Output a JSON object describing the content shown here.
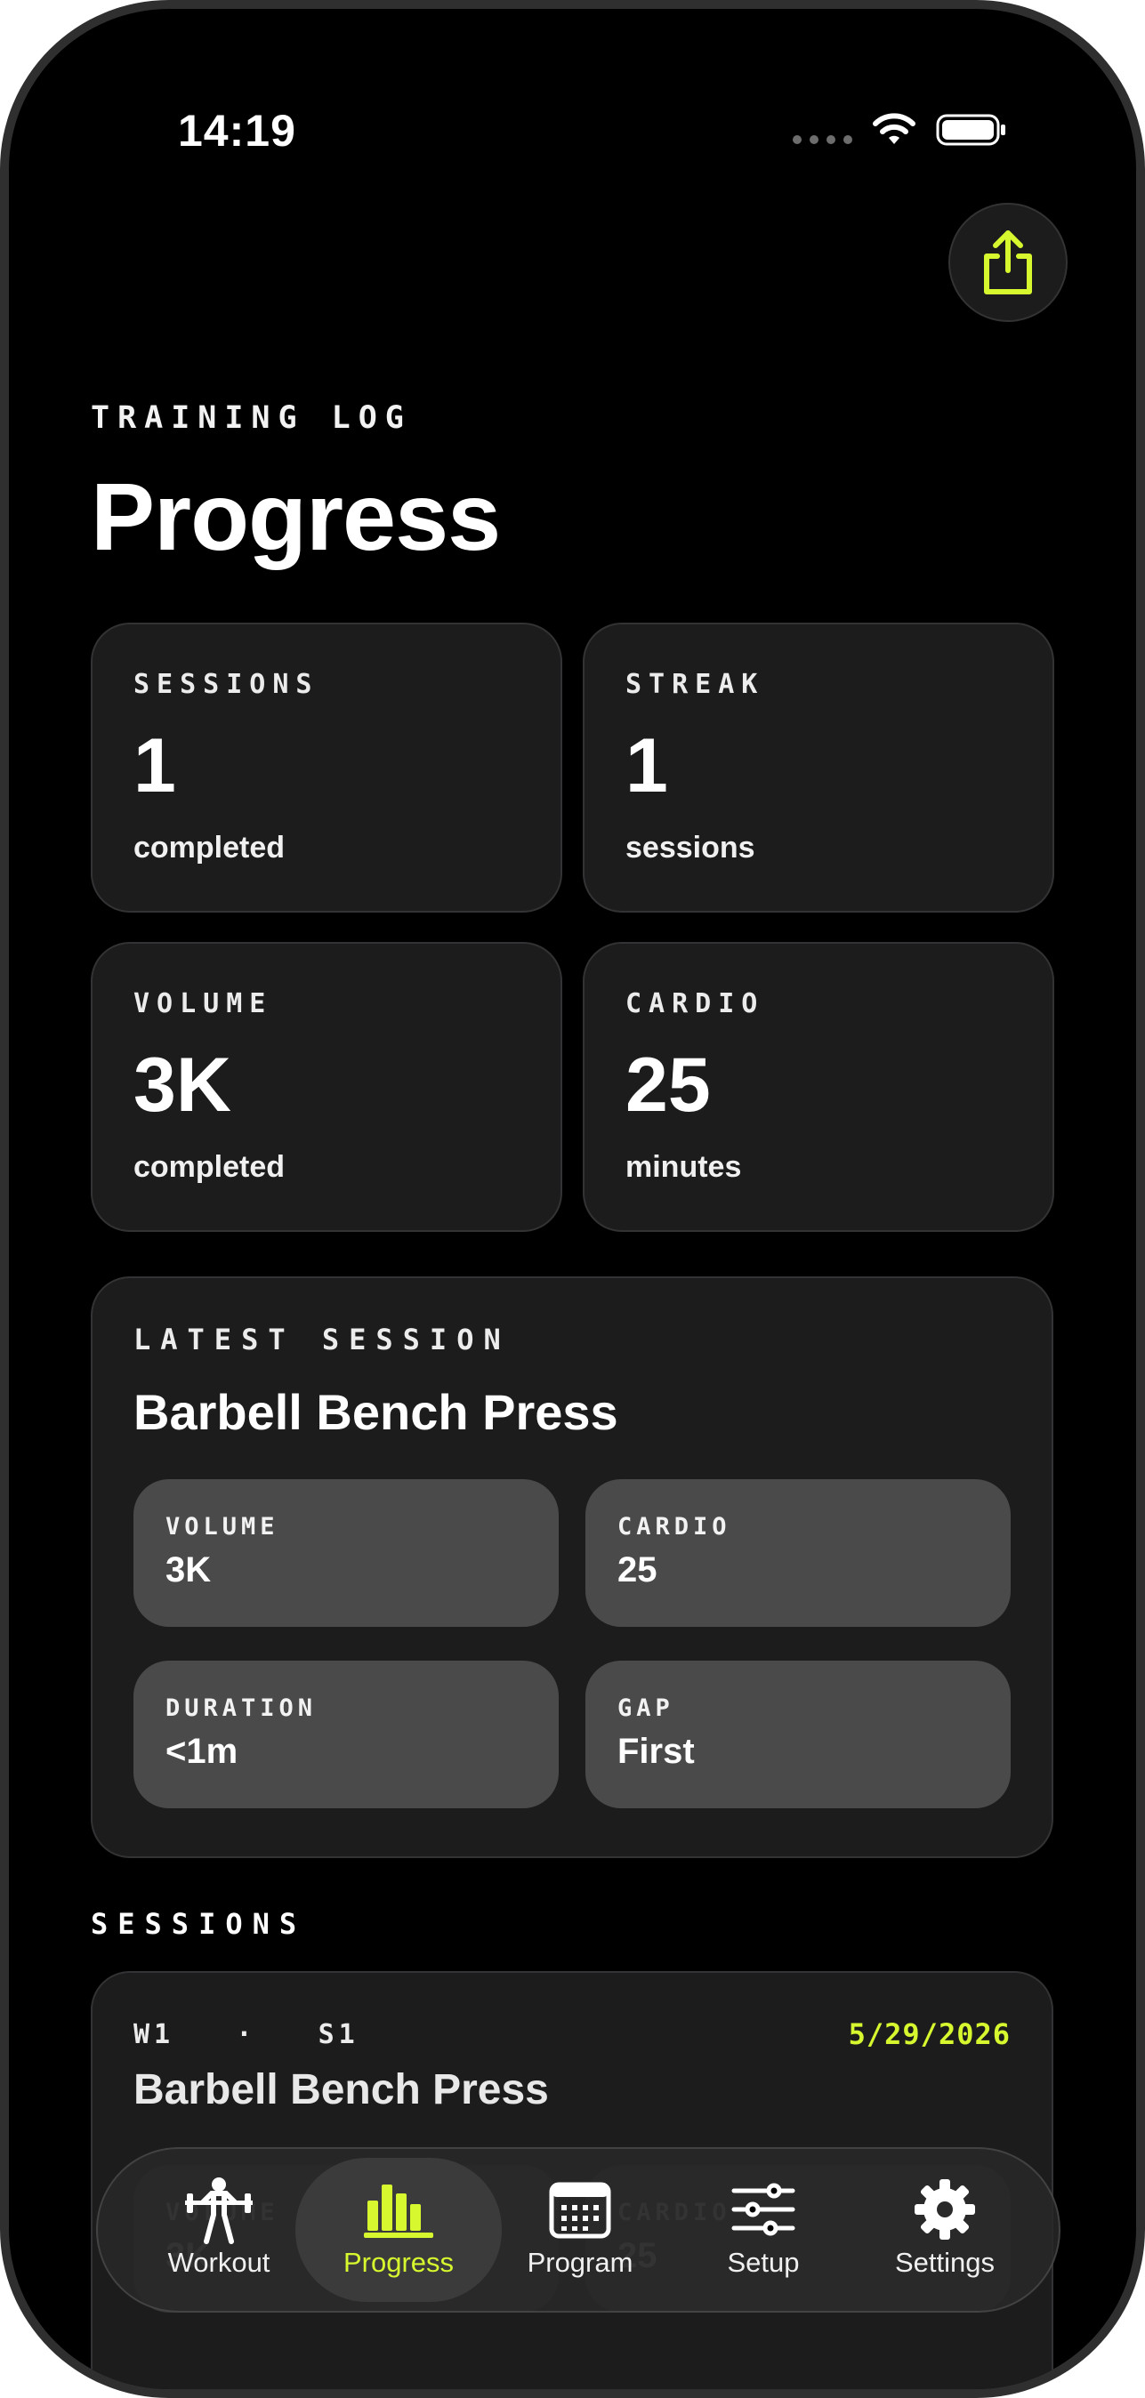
{
  "status_bar": {
    "time": "14:19"
  },
  "header": {
    "overline": "TRAINING LOG",
    "title": "Progress"
  },
  "stats": [
    {
      "label": "SESSIONS",
      "value": "1",
      "sub": "completed"
    },
    {
      "label": "STREAK",
      "value": "1",
      "sub": "sessions"
    },
    {
      "label": "VOLUME",
      "value": "3K",
      "sub": "completed"
    },
    {
      "label": "CARDIO",
      "value": "25",
      "sub": "minutes"
    }
  ],
  "latest_session": {
    "label": "LATEST SESSION",
    "title": "Barbell Bench Press",
    "tiles": [
      {
        "label": "VOLUME",
        "value": "3K"
      },
      {
        "label": "CARDIO",
        "value": "25"
      },
      {
        "label": "DURATION",
        "value": "<1m"
      },
      {
        "label": "GAP",
        "value": "First"
      }
    ]
  },
  "sessions": {
    "label": "SESSIONS",
    "items": [
      {
        "week": "W1",
        "separator": "·",
        "session": "S1",
        "date": "5/29/2026",
        "title": "Barbell Bench Press"
      }
    ]
  },
  "tabbar": {
    "tabs": [
      {
        "label": "Workout",
        "icon": "weightlifter-icon"
      },
      {
        "label": "Progress",
        "icon": "bar-chart-icon",
        "active": true
      },
      {
        "label": "Program",
        "icon": "calendar-icon"
      },
      {
        "label": "Setup",
        "icon": "sliders-icon"
      },
      {
        "label": "Settings",
        "icon": "gear-icon"
      }
    ]
  },
  "colors": {
    "accent": "#d7f72e",
    "background": "#000000",
    "card": "#1c1c1d",
    "tile": "#4a4a4a"
  }
}
